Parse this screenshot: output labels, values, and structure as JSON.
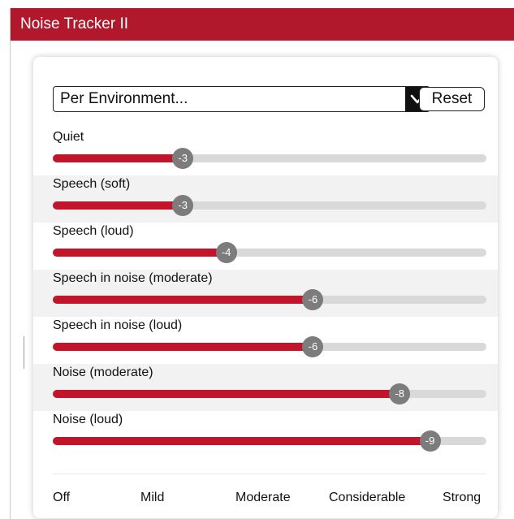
{
  "window": {
    "title": "Noise Tracker II"
  },
  "colors": {
    "accent": "#b2182b",
    "fill": "#c0152b",
    "thumb": "#7c7c7c",
    "track": "#d9d9d9"
  },
  "dropdown": {
    "value": "Per Environment...",
    "icon": "chevron-down-icon"
  },
  "reset_label": "Reset",
  "sliders": [
    {
      "label": "Quiet",
      "value": "-3",
      "level": 0.3
    },
    {
      "label": "Speech (soft)",
      "value": "-3",
      "level": 0.3
    },
    {
      "label": "Speech (loud)",
      "value": "-4",
      "level": 0.4
    },
    {
      "label": "Speech in noise (moderate)",
      "value": "-6",
      "level": 0.6
    },
    {
      "label": "Speech in noise (loud)",
      "value": "-6",
      "level": 0.6
    },
    {
      "label": "Noise (moderate)",
      "value": "-8",
      "level": 0.8
    },
    {
      "label": "Noise (loud)",
      "value": "-9",
      "level": 0.87
    }
  ],
  "scale": [
    "Off",
    "Mild",
    "Moderate",
    "Considerable",
    "Strong"
  ]
}
